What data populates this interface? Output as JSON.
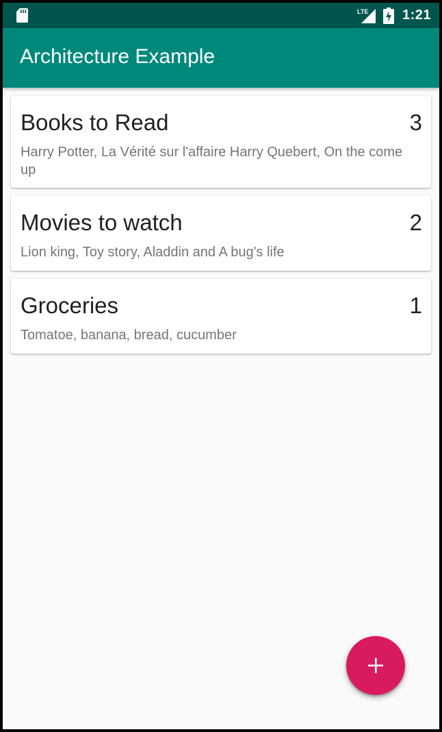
{
  "status_bar": {
    "network_label": "LTE",
    "time": "1:21",
    "icons": [
      "sd-card-icon",
      "lte-signal-icon",
      "battery-charging-icon"
    ]
  },
  "app_bar": {
    "title": "Architecture Example"
  },
  "lists": [
    {
      "title": "Books to Read",
      "count": "3",
      "items": "Harry Potter, La Vérité sur l'affaire Harry Quebert, On the come up"
    },
    {
      "title": "Movies to watch",
      "count": "2",
      "items": "Lion king, Toy story, Aladdin and A bug's life"
    },
    {
      "title": "Groceries",
      "count": "1",
      "items": "Tomatoe, banana, bread, cucumber"
    }
  ],
  "fab": {
    "icon": "plus-icon"
  },
  "colors": {
    "status_bar": "#00564D",
    "app_bar": "#00897B",
    "fab": "#D81B60",
    "background": "#FAFAFA"
  }
}
